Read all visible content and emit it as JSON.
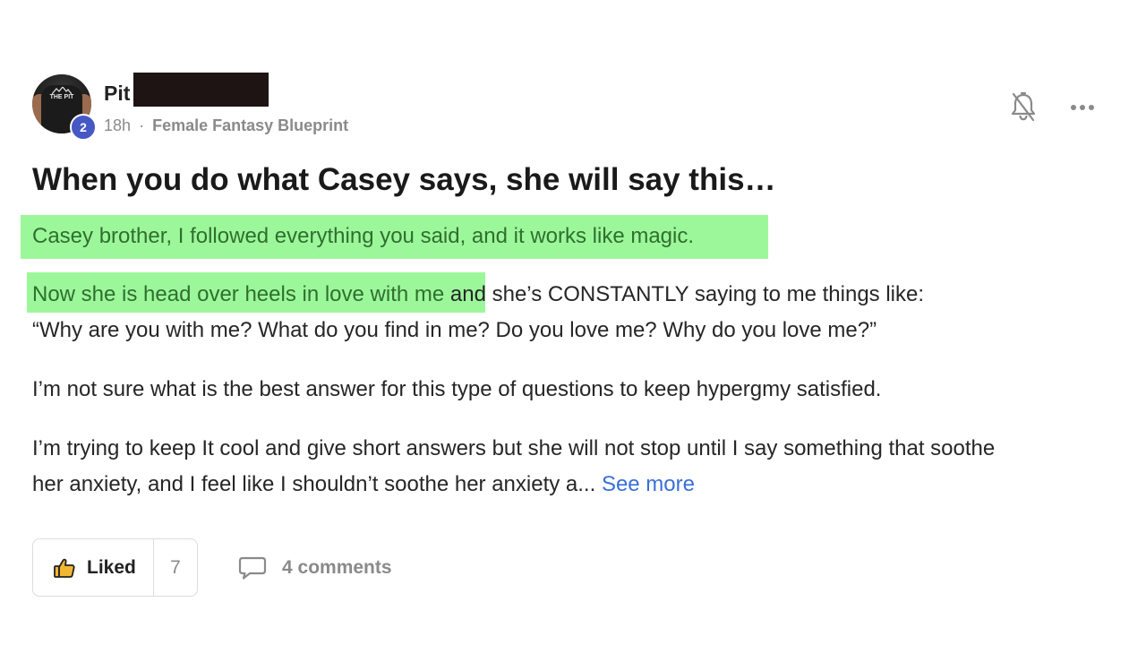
{
  "post": {
    "author": {
      "name": "Pit",
      "level": "2",
      "avatar_text": "THE PIT"
    },
    "meta": {
      "time": "18h",
      "separator": "·",
      "category": "Female Fantasy Blueprint"
    },
    "title": "When you do what Casey says, she will say this…",
    "body": {
      "p1_highlighted": "Casey brother, I followed everything you said, and it works like magic.",
      "p2_highlighted": "Now she is head over heels in love with me",
      "p2_rest": " and she’s CONSTANTLY saying to me things like:",
      "p2_line2": "“Why are you with me? What do you find in me? Do you love me? Why do you love me?”",
      "p3": "I’m not sure what is the best answer for this type of questions to keep hypergmy satisfied.",
      "p4_line1": "I’m trying to keep It cool and give short answers but she will not stop until I say something that soothe",
      "p4_line2": "her anxiety, and I feel like I shouldn’t soothe her anxiety a...",
      "see_more": "See more"
    },
    "actions": {
      "like_label": "Liked",
      "like_count": "7",
      "comments_label": "4 comments"
    },
    "icons": {
      "bell": "bell-off-icon",
      "more": "more-horizontal-icon",
      "like": "thumbs-up-icon",
      "comment": "comment-icon"
    },
    "colors": {
      "highlight": "#9cf79b",
      "link": "#3a6fd8",
      "level_badge": "#4558c4",
      "like_icon": "#f2b632"
    }
  }
}
